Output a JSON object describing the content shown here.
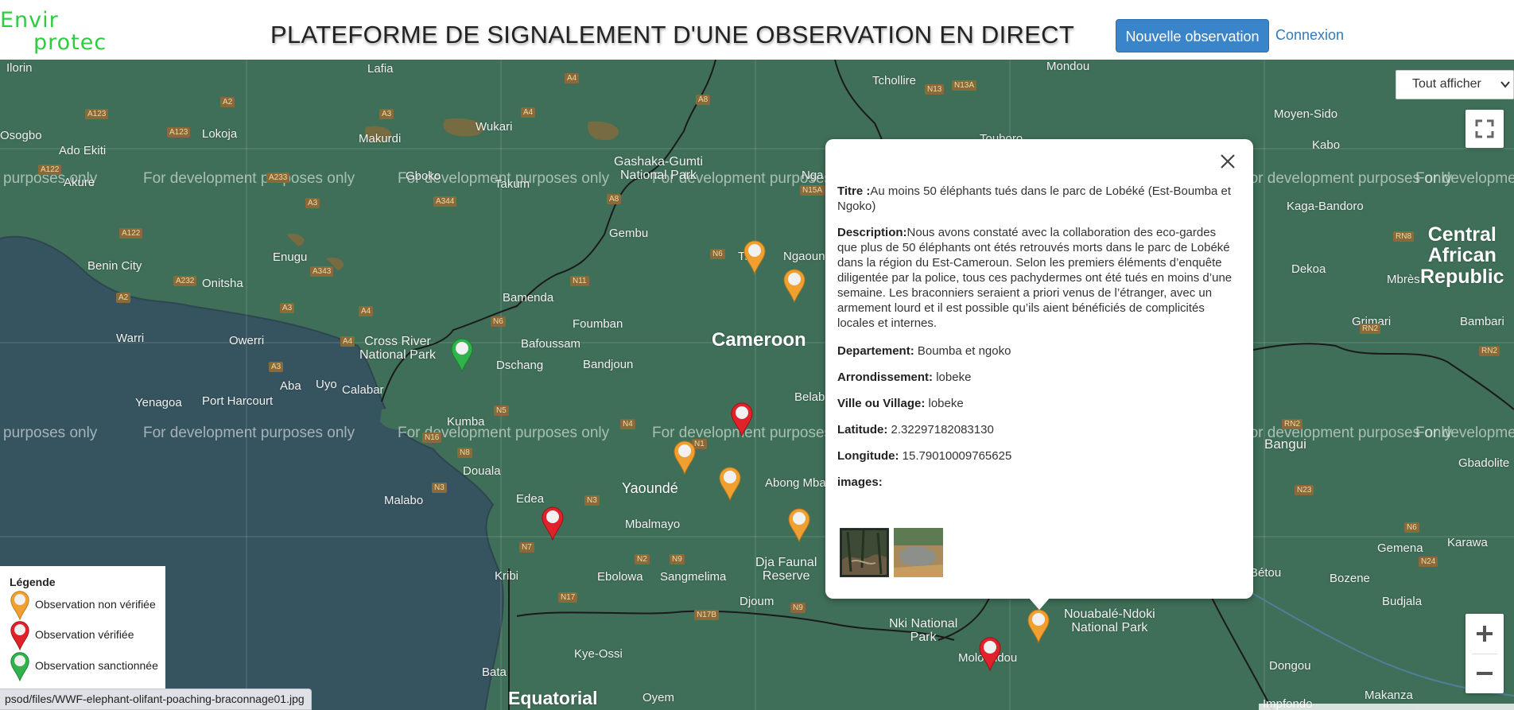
{
  "header": {
    "logo_line1": "Envir",
    "logo_line2": "protec",
    "title": "PLATEFORME DE SIGNALEMENT D'UNE OBSERVATION EN DIRECT",
    "new_observation_label": "Nouvelle observation",
    "login_label": "Connexion"
  },
  "map": {
    "filter_value": "Tout afficher",
    "dev_watermark": "For development purposes only",
    "watermark_partial_left": "purposes only",
    "watermark_partial_right": "For developme",
    "labels": {
      "ilorin": "Ilorin",
      "lafia": "Lafia",
      "osogbo": "Osogbo",
      "lokoja": "Lokoja",
      "wukari": "Wukari",
      "makurdi": "Makurdi",
      "ado_ekiti": "Ado Ekiti",
      "akure": "Akure",
      "gboko": "Gboko",
      "takum": "Takum",
      "gashaka": "Gashaka-Gumti\nNational Park",
      "gembu": "Gembu",
      "benin_city": "Benin City",
      "enugu": "Enugu",
      "onitsha": "Onitsha",
      "bamenda": "Bamenda",
      "foumban": "Foumban",
      "warri": "Warri",
      "owerri": "Owerri",
      "cross_river": "Cross River\nNational Park",
      "bafoussam": "Bafoussam",
      "dschang": "Dschang",
      "bandjoun": "Bandjoun",
      "cameroon": "Cameroon",
      "aba": "Aba",
      "uyo": "Uyo",
      "calabar": "Calabar",
      "yenagoa": "Yenagoa",
      "port_harcourt": "Port Harcourt",
      "kumba": "Kumba",
      "douala": "Douala",
      "yaounde": "Yaoundé",
      "malabo": "Malabo",
      "edea": "Edea",
      "mbalmayo": "Mbalmayo",
      "kribi": "Kribi",
      "ebolowa": "Ebolowa",
      "sangmelima": "Sangmelima",
      "djoum": "Djoum",
      "dja": "Dja Faunal\nReserve",
      "abong": "Abong Mbang",
      "nki": "Nki National\nPark",
      "moloundou": "Moloundou",
      "nouabale": "Nouabalé-Ndoki\nNational Park",
      "kye_ossi": "Kye-Ossi",
      "bata": "Bata",
      "oyem": "Oyem",
      "equatorial": "Equatorial",
      "tchollire": "Tchollire",
      "mondou": "Mondou",
      "touboro": "Touboro",
      "moyen_sido": "Moyen-Sido",
      "kabo": "Kabo",
      "kaga_bandoro": "Kaga-Bandoro",
      "car": "Central\nAfrican\nRepublic",
      "mbres": "Mbrès",
      "dekoa": "Dekoa",
      "grimari": "Grimari",
      "bambari": "Bambari",
      "bangui": "Bangui",
      "gbadolite": "Gbadolite",
      "betou": "Bétou",
      "bozene": "Bozene",
      "gemena": "Gemena",
      "karawa": "Karawa",
      "budjala": "Budjala",
      "dongou": "Dongou",
      "makanza": "Makanza",
      "impfondo": "Impfondo",
      "ngaoundere": "Ngaoun",
      "tibati": "Ti",
      "belabo": "Belab",
      "nga": "Nga"
    },
    "roads": {
      "a123": "A123",
      "a2": "A2",
      "a3": "A3",
      "a4": "A4",
      "a6": "A6",
      "a8": "A8",
      "a122": "A122",
      "a232": "A232",
      "a233": "A233",
      "a344": "A344",
      "a343": "A343",
      "n6": "N6",
      "n11": "N11",
      "n5": "N5",
      "n4": "N4",
      "n1": "N1",
      "n8": "N8",
      "n16": "N16",
      "n3": "N3",
      "n7": "N7",
      "n2": "N2",
      "n9": "N9",
      "n17": "N17",
      "n17b": "N17B",
      "n13": "N13",
      "n13a": "N13A",
      "n15a": "N15A",
      "rn8": "RN8",
      "rn2": "RN2",
      "n23": "N23",
      "n24": "N24"
    }
  },
  "popup": {
    "title_label": "Titre :",
    "title_value": "Au moins 50 éléphants tués dans le parc de Lobéké (Est-Boumba et Ngoko)",
    "description_label": "Description:",
    "description_value": "Nous avons constaté avec la collaboration des eco-gardes que plus de 50 éléphants ont étés retrouvés morts dans le parc de Lobéké dans la région du Est-Cameroun. Selon les premiers éléments d’enquête diligentée par la police, tous ces pachydermes ont été tués en moins d’une semaine. Les braconniers seraient a priori venus de l’étranger, avec un armement lourd et il est possible qu’ils aient bénéficiés de complicités locales et internes.",
    "departement_label": "Departement:",
    "departement_value": "Boumba et ngoko",
    "arrondissement_label": "Arrondissement:",
    "arrondissement_value": "lobeke",
    "ville_label": "Ville ou Village:",
    "ville_value": "lobeke",
    "latitude_label": "Latitude:",
    "latitude_value": "2.32297182083130",
    "longitude_label": "Longitude:",
    "longitude_value": "15.79010009765625",
    "images_label": "images:"
  },
  "legend": {
    "title": "Légende",
    "items": [
      {
        "label": "Observation non vérifiée",
        "color": "#f0a030"
      },
      {
        "label": "Observation vérifiée",
        "color": "#e0222a"
      },
      {
        "label": "Observation sanctionnée",
        "color": "#2fb34a"
      }
    ]
  },
  "status_bar": {
    "url": "psod/files/WWF-elephant-olifant-poaching-braconnage01.jpg"
  },
  "colors": {
    "accent": "#3a85c9",
    "link": "#337ab7",
    "logo": "#2ecc40",
    "map_land": "#3f6f58",
    "map_water": "#36545f"
  }
}
